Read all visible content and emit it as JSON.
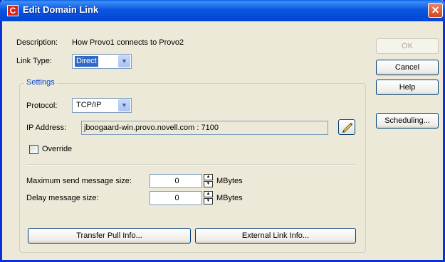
{
  "window": {
    "title": "Edit Domain Link",
    "close_symbol": "✕",
    "app_icon_letter": "C"
  },
  "description": {
    "label": "Description:",
    "value": "How Provo1 connects to Provo2"
  },
  "link_type": {
    "label": "Link Type:",
    "value": "Direct"
  },
  "settings": {
    "title": "Settings",
    "protocol": {
      "label": "Protocol:",
      "value": "TCP/IP"
    },
    "ip_address": {
      "label": "IP Address:",
      "value": "jboogaard-win.provo.novell.com : 7100"
    },
    "override": {
      "label": "Override",
      "checked": false
    },
    "max_send": {
      "label": "Maximum send message size:",
      "value": "0",
      "unit": "MBytes"
    },
    "delay": {
      "label": "Delay message size:",
      "value": "0",
      "unit": "MBytes"
    },
    "transfer_pull_label": "Transfer Pull Info...",
    "external_link_label": "External Link Info..."
  },
  "buttons": {
    "ok": "OK",
    "cancel": "Cancel",
    "help": "Help",
    "scheduling": "Scheduling..."
  },
  "colors": {
    "titlebar": "#0054e3",
    "dialog_bg": "#ece9d8",
    "group_title": "#0046d5",
    "selection": "#316ac5"
  }
}
